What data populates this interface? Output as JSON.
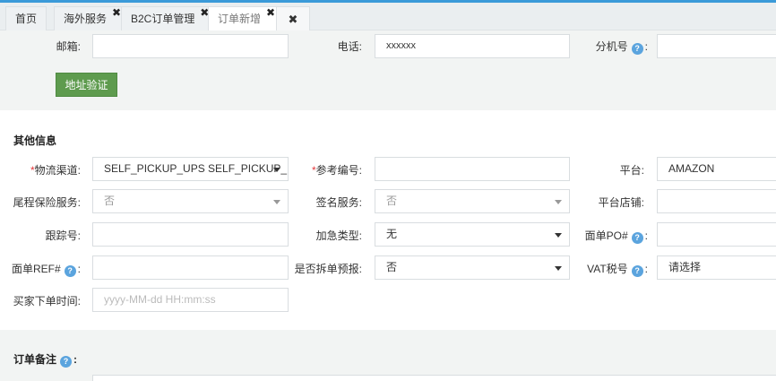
{
  "tabs": [
    {
      "label": "首页",
      "closable": false
    },
    {
      "label": "海外服务",
      "closable": true
    },
    {
      "label": "B2C订单管理",
      "closable": true
    },
    {
      "label": "订单新增",
      "closable": true,
      "active": true
    }
  ],
  "close_all_glyph": "✖",
  "tab_close_glyph": "✖",
  "address": {
    "email_label": "邮箱:",
    "email_value": "",
    "phone_label": "电话:",
    "phone_value": "xxxxxx",
    "ext_label": "分机号",
    "ext_value": "",
    "verify_button": "地址验证"
  },
  "other_info": {
    "title": "其他信息",
    "required_mark": "*",
    "logistics_label": "物流渠道:",
    "logistics_value": "SELF_PICKUP_UPS SELF_PICKUP_...",
    "ref_no_label": "参考编号:",
    "ref_no_value": "",
    "platform_label": "平台:",
    "platform_value": "AMAZON",
    "last_mile_ins_label": "尾程保险服务:",
    "last_mile_ins_value": "否",
    "signature_label": "签名服务:",
    "signature_value": "否",
    "platform_store_label": "平台店铺:",
    "platform_store_value": "",
    "tracking_label": "跟踪号:",
    "tracking_value": "",
    "urgent_label": "加急类型:",
    "urgent_value": "无",
    "po_label": "面单PO#",
    "po_value": "",
    "ref_hash_label": "面单REF#",
    "ref_hash_value": "",
    "split_label": "是否拆单预报:",
    "split_value": "否",
    "vat_label": "VAT税号",
    "vat_value": "请选择",
    "order_time_label": "买家下单时间:",
    "order_time_placeholder": "yyyy-MM-dd HH:mm:ss"
  },
  "order_note": {
    "title": "订单备注"
  },
  "help_glyph": "?",
  "colon": ":",
  "colors": {
    "accent": "#3b9ad9",
    "verify_button": "#5e9b4e",
    "help_icon": "#5ba4de",
    "required": "#e4393c"
  }
}
